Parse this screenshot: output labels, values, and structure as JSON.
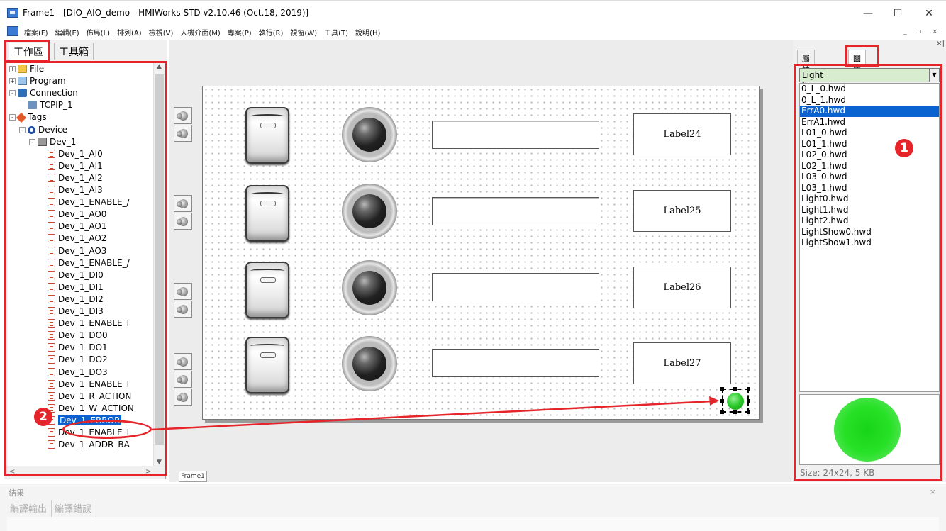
{
  "window": {
    "title": "Frame1 - [DIO_AIO_demo - HMIWorks STD v2.10.46 (Oct.18, 2019)]",
    "controls": [
      "—",
      "☐",
      "✕"
    ]
  },
  "menu": [
    "檔案(F)",
    "編輯(E)",
    "佈局(L)",
    "排列(A)",
    "檢視(V)",
    "人機介面(M)",
    "專案(P)",
    "執行(R)",
    "視窗(W)",
    "工具(T)",
    "說明(H)"
  ],
  "mdi_controls": "_ ▫ ×",
  "left_panel": {
    "tabs": [
      "工作區",
      "工具箱"
    ],
    "tree": [
      {
        "label": "File",
        "level": 0,
        "expander": "+",
        "icon": "folder"
      },
      {
        "label": "Program",
        "level": 0,
        "expander": "+",
        "icon": "program"
      },
      {
        "label": "Connection",
        "level": 0,
        "expander": "-",
        "icon": "connection"
      },
      {
        "label": "TCPIP_1",
        "level": 1,
        "expander": "",
        "icon": "tcpip"
      },
      {
        "label": "Tags",
        "level": 0,
        "expander": "-",
        "icon": "tags"
      },
      {
        "label": "Device",
        "level": 1,
        "expander": "-",
        "icon": "device"
      },
      {
        "label": "Dev_1",
        "level": 2,
        "expander": "-",
        "icon": "dev"
      },
      {
        "label": "Dev_1_AI0",
        "level": 3,
        "expander": "",
        "icon": "tag"
      },
      {
        "label": "Dev_1_AI1",
        "level": 3,
        "expander": "",
        "icon": "tag"
      },
      {
        "label": "Dev_1_AI2",
        "level": 3,
        "expander": "",
        "icon": "tag"
      },
      {
        "label": "Dev_1_AI3",
        "level": 3,
        "expander": "",
        "icon": "tag"
      },
      {
        "label": "Dev_1_ENABLE_/",
        "level": 3,
        "expander": "",
        "icon": "tag"
      },
      {
        "label": "Dev_1_AO0",
        "level": 3,
        "expander": "",
        "icon": "tag"
      },
      {
        "label": "Dev_1_AO1",
        "level": 3,
        "expander": "",
        "icon": "tag"
      },
      {
        "label": "Dev_1_AO2",
        "level": 3,
        "expander": "",
        "icon": "tag"
      },
      {
        "label": "Dev_1_AO3",
        "level": 3,
        "expander": "",
        "icon": "tag"
      },
      {
        "label": "Dev_1_ENABLE_/",
        "level": 3,
        "expander": "",
        "icon": "tag"
      },
      {
        "label": "Dev_1_DI0",
        "level": 3,
        "expander": "",
        "icon": "tag"
      },
      {
        "label": "Dev_1_DI1",
        "level": 3,
        "expander": "",
        "icon": "tag"
      },
      {
        "label": "Dev_1_DI2",
        "level": 3,
        "expander": "",
        "icon": "tag"
      },
      {
        "label": "Dev_1_DI3",
        "level": 3,
        "expander": "",
        "icon": "tag"
      },
      {
        "label": "Dev_1_ENABLE_I",
        "level": 3,
        "expander": "",
        "icon": "tag"
      },
      {
        "label": "Dev_1_DO0",
        "level": 3,
        "expander": "",
        "icon": "tag"
      },
      {
        "label": "Dev_1_DO1",
        "level": 3,
        "expander": "",
        "icon": "tag"
      },
      {
        "label": "Dev_1_DO2",
        "level": 3,
        "expander": "",
        "icon": "tag"
      },
      {
        "label": "Dev_1_DO3",
        "level": 3,
        "expander": "",
        "icon": "tag"
      },
      {
        "label": "Dev_1_ENABLE_I",
        "level": 3,
        "expander": "",
        "icon": "tag"
      },
      {
        "label": "Dev_1_R_ACTION",
        "level": 3,
        "expander": "",
        "icon": "tag"
      },
      {
        "label": "Dev_1_W_ACTION",
        "level": 3,
        "expander": "",
        "icon": "tag"
      },
      {
        "label": "Dev_1_ERROR",
        "level": 3,
        "expander": "",
        "icon": "tag",
        "selected": true
      },
      {
        "label": "Dev_1_ENABLE_I",
        "level": 3,
        "expander": "",
        "icon": "tag"
      },
      {
        "label": "Dev_1_ADDR_BA",
        "level": 3,
        "expander": "",
        "icon": "tag"
      }
    ]
  },
  "canvas": {
    "rows": [
      {
        "label": "Label24"
      },
      {
        "label": "Label25"
      },
      {
        "label": "Label26"
      },
      {
        "label": "Label27"
      }
    ],
    "frame_tab": "Frame1"
  },
  "right_panel": {
    "tabs": [
      "屬性檢視區",
      "圖庫"
    ],
    "category": "Light",
    "files": [
      "0_L_0.hwd",
      "0_L_1.hwd",
      "ErrA0.hwd",
      "ErrA1.hwd",
      "L01_0.hwd",
      "L01_1.hwd",
      "L02_0.hwd",
      "L02_1.hwd",
      "L03_0.hwd",
      "L03_1.hwd",
      "Light0.hwd",
      "Light1.hwd",
      "Light2.hwd",
      "LightShow0.hwd",
      "LightShow1.hwd"
    ],
    "selected_file": "ErrA0.hwd",
    "size_text": "Size: 24x24, 5 KB"
  },
  "bottom_panel": {
    "title": "結果",
    "tabs": [
      "編譯輸出",
      "編譯錯誤"
    ]
  },
  "annotations": {
    "marker1": "1",
    "marker2": "2",
    "color": "#e5252a"
  },
  "colors": {
    "selection": "#0a62d0",
    "category_bg": "#d8ecd0",
    "light_green": "#27e127"
  }
}
